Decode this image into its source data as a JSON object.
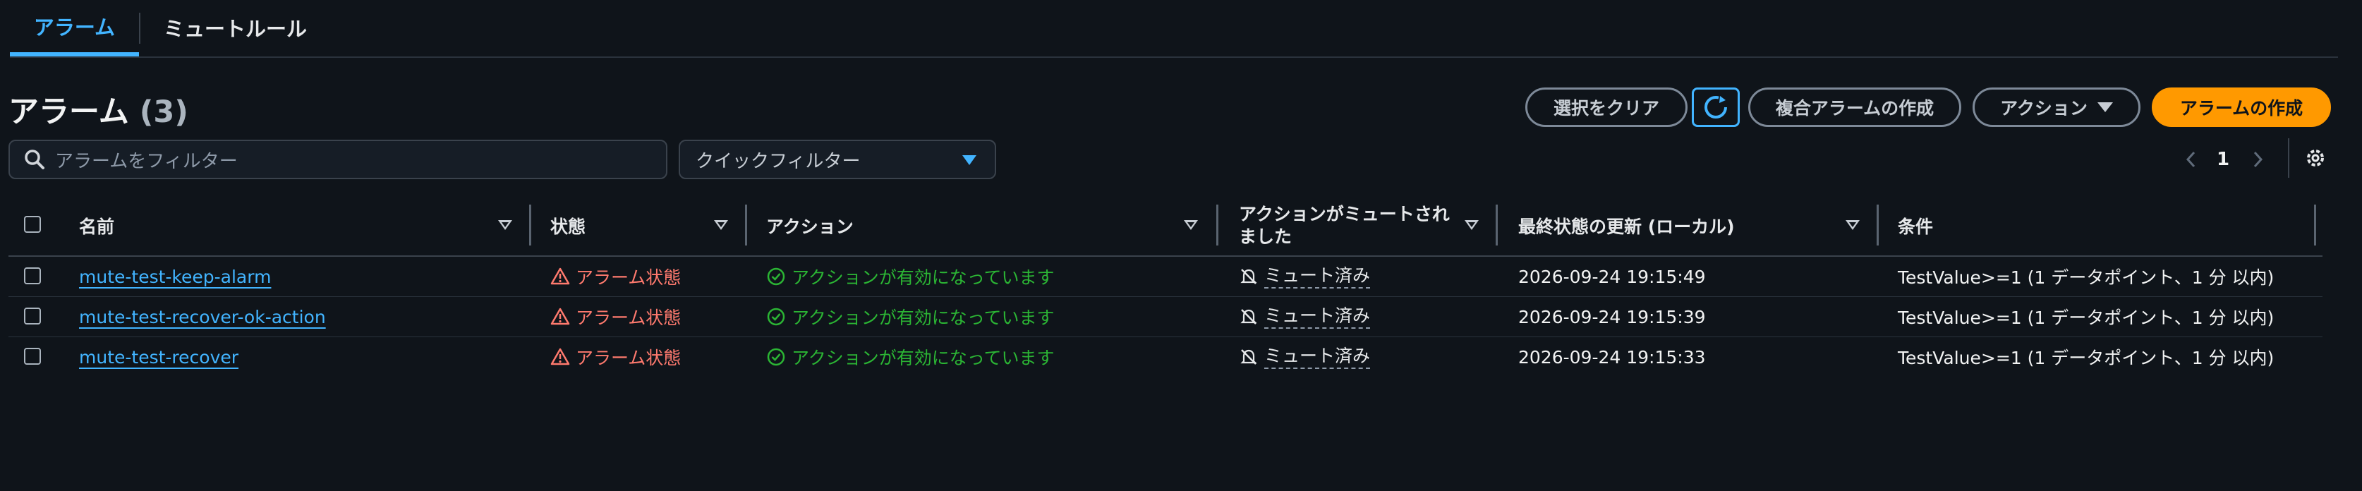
{
  "tabs": [
    {
      "label": "アラーム",
      "active": true
    },
    {
      "label": "ミュートルール",
      "active": false
    }
  ],
  "page": {
    "title": "アラーム",
    "count": "(3)"
  },
  "toolbar": {
    "clear_selection": "選択をクリア",
    "composite_create": "複合アラームの作成",
    "actions": "アクション",
    "create_alarm": "アラームの作成"
  },
  "filter": {
    "placeholder": "アラームをフィルター"
  },
  "quick_filter": {
    "placeholder": "クイックフィルター"
  },
  "pagination": {
    "current": "1"
  },
  "columns": {
    "name": "名前",
    "state": "状態",
    "actions": "アクション",
    "muted_line1": "アクションがミュートされ",
    "muted_line2": "ました",
    "updated": "最終状態の更新 (ローカル)",
    "conditions": "条件"
  },
  "rows": [
    {
      "name": "mute-test-keep-alarm",
      "state": "アラーム状態",
      "actions": "アクションが有効になっています",
      "muted": "ミュート済み",
      "updated": "2026-09-24 19:15:49",
      "conditions": "TestValue>=1 (1 データポイント、1 分 以内)"
    },
    {
      "name": "mute-test-recover-ok-action",
      "state": "アラーム状態",
      "actions": "アクションが有効になっています",
      "muted": "ミュート済み",
      "updated": "2026-09-24 19:15:39",
      "conditions": "TestValue>=1 (1 データポイント、1 分 以内)"
    },
    {
      "name": "mute-test-recover",
      "state": "アラーム状態",
      "actions": "アクションが有効になっています",
      "muted": "ミュート済み",
      "updated": "2026-09-24 19:15:33",
      "conditions": "TestValue>=1 (1 データポイント、1 分 以内)"
    }
  ],
  "colors": {
    "accent": "#42b4ff",
    "primary": "#ff9900",
    "alarm": "#ff7a6e",
    "ok": "#2bb534",
    "background": "#0f141a"
  },
  "icons": [
    "search-icon",
    "refresh-icon",
    "caret-down-icon",
    "chevron-left-icon",
    "chevron-right-icon",
    "gear-icon",
    "warning-icon",
    "check-circle-icon",
    "bell-slash-icon"
  ]
}
